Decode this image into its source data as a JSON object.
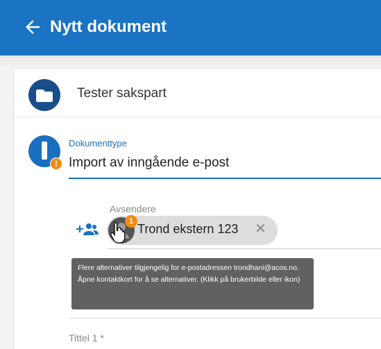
{
  "header": {
    "title": "Nytt dokument",
    "background": "#1a73c3"
  },
  "case": {
    "title": "Tester sakspart",
    "icon": "folder-icon"
  },
  "document_type": {
    "label": "Dokumenttype",
    "value": "Import av inngående e-post",
    "icon": "document-info-icon",
    "warning_badge": "!"
  },
  "senders": {
    "label": "Avsendere",
    "add_icon": "add-person-icon",
    "chip": {
      "name": "Trond ekstern 123",
      "badge": "1",
      "remove_icon": "close-icon"
    }
  },
  "tooltip": {
    "text": "Flere alternativer tilgjengelig for e-postadressen trondhani@acos.no. Åpne kontaktkort for å se alternativer. (Klikk på brukerbilde eller ikon)"
  },
  "title_field": {
    "label": "Tittel 1 *"
  },
  "colors": {
    "accent": "#1a6fc0",
    "warning": "#f08c12",
    "tooltip_bg": "#616161"
  }
}
